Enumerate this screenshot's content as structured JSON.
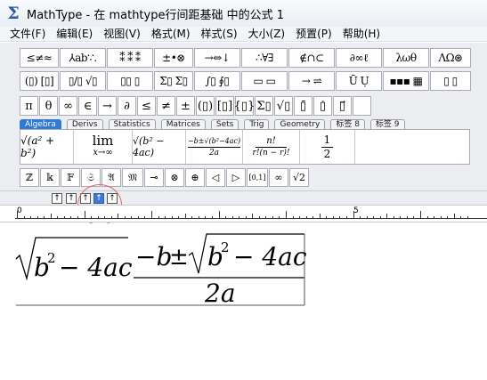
{
  "window": {
    "app_name": "MathType",
    "title": "MathType - 在 mathtype行间距基础 中的公式 1"
  },
  "menu": {
    "items": [
      "文件(F)",
      "编辑(E)",
      "视图(V)",
      "格式(M)",
      "样式(S)",
      "大小(Z)",
      "预置(P)",
      "帮助(H)"
    ]
  },
  "palettes": {
    "row1": [
      "≤≠≈",
      "⅄ab∵.",
      "⁑ ⁑ ⁑",
      "±•⊗",
      "→⇔↓",
      "∴∀∃",
      "∉∩⊂",
      "∂∞ℓ",
      "λωθ",
      "ΛΩ⊛"
    ],
    "row2": [
      "(▯) [▯]",
      "▯/▯ √▯",
      "▯▯ ▯",
      "Σ▯ Σ▯",
      "∫▯ ∮▯",
      "▭ ▭",
      "→ ⇌",
      "Ū Ụ",
      "▪▪▪ ▦",
      "▯ ▯"
    ]
  },
  "symbols": [
    "π",
    "θ",
    "∞",
    "∈",
    "→",
    "∂",
    "≤",
    "≠",
    "±",
    "(▯)",
    "[▯]",
    "{▯}",
    "Σ▯",
    "√▯",
    "▯̄",
    "▯̇",
    "▯⃗",
    ""
  ],
  "tabs": [
    "Algebra",
    "Derivs",
    "Statistics",
    "Matrices",
    "Sets",
    "Trig",
    "Geometry",
    "标签 8",
    "标签 9"
  ],
  "templates": {
    "sqrt_sum": "√(a² + b²)",
    "lim_top": "lim",
    "lim_bottom": "x→∞",
    "disc": "√(b² − 4ac)",
    "quad_num": "−b±√(b²−4ac)",
    "quad_den": "2a",
    "comb_num": "n!",
    "comb_den": "r!(n − r)!",
    "half_num": "1",
    "half_den": "2"
  },
  "small_symbols": [
    "ℤ",
    "𝕜",
    "𝔽",
    "𝔖",
    "𝔄",
    "𝔐",
    "⊸",
    "⊗",
    "⊕",
    "◁",
    "▷",
    "[0,1]",
    "∞",
    "√2"
  ],
  "nudge_buttons": [
    "↑",
    "↑",
    "↑",
    "↑",
    "↑"
  ],
  "ruler": {
    "marks": [
      "0",
      "5"
    ]
  },
  "formula": {
    "b": "b",
    "exp": "2",
    "minus_4ac": "− 4ac",
    "numerator_minus_b": "−b",
    "pm": "±",
    "num_b": "b",
    "num_exp": "2",
    "num_minus_4ac": "− 4ac",
    "denominator": "2a"
  },
  "colors": {
    "accent_tab": "#2f7ad6",
    "highlight_circle": "#e06666"
  }
}
